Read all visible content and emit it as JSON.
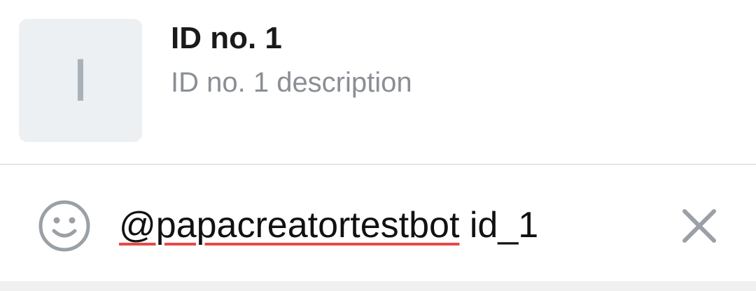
{
  "result": {
    "thumb_letter": "I",
    "title": "ID no. 1",
    "description": "ID no. 1 description"
  },
  "input": {
    "mention": "@papacreatortestbot",
    "query": " id_1",
    "icons": {
      "left": "emoji-icon",
      "right": "close-icon"
    }
  },
  "colors": {
    "thumb_bg": "#edf0f3",
    "thumb_letter": "#a9b1b9",
    "title": "#1a1a1a",
    "description": "#8a8f95",
    "spellcheck_underline": "#e64a4a",
    "icon_gray": "#9aa0a6"
  }
}
